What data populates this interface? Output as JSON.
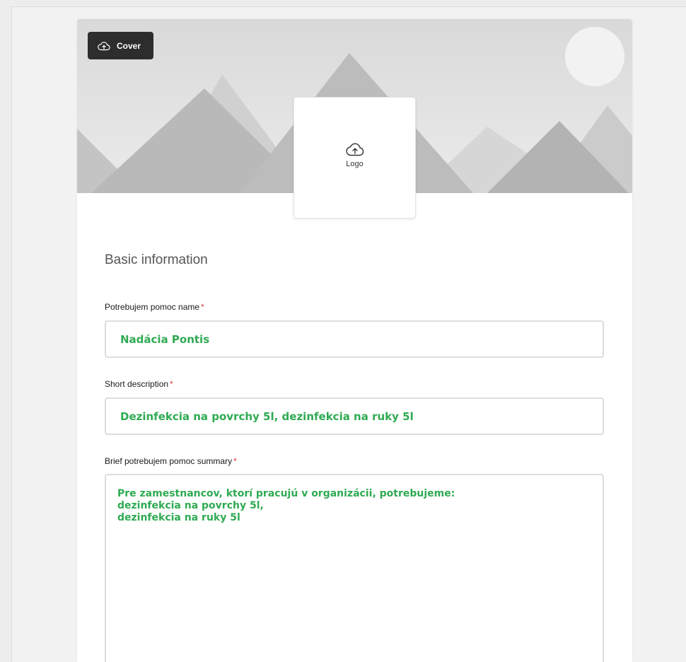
{
  "cover": {
    "button_label": "Cover",
    "button_icon": "cloud-upload-icon",
    "colors": {
      "sky": "#e6e6e6",
      "mountain_light": "#cccccc",
      "mountain_mid": "#bdbdbd",
      "mountain_dark": "#aeaeae",
      "sun": "#f2f2f2"
    }
  },
  "logo": {
    "label": "Logo",
    "icon": "cloud-upload-icon"
  },
  "section": {
    "title": "Basic information"
  },
  "fields": {
    "name": {
      "label": "Potrebujem pomoc name",
      "required_mark": "*",
      "value": "Nadácia Pontis"
    },
    "short_description": {
      "label": "Short description",
      "required_mark": "*",
      "value": "Dezinfekcia na povrchy 5l, dezinfekcia na ruky 5l"
    },
    "summary": {
      "label": "Brief potrebujem pomoc summary",
      "required_mark": "*",
      "value": "Pre zamestnancov, ktorí pracujú v organizácii, potrebujeme:\ndezinfekcia na povrchy 5l,\ndezinfekcia na ruky 5l"
    }
  },
  "colors": {
    "value_text": "#2faa52",
    "required": "#e03a3a",
    "input_border": "#dddddd"
  }
}
